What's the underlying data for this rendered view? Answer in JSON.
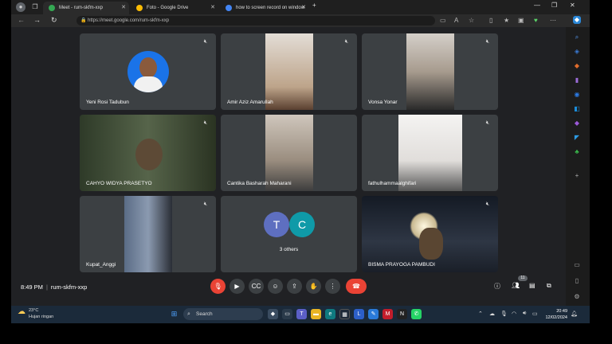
{
  "browser": {
    "tabs": [
      {
        "title": "Meet - rum-skfm-xxp",
        "fav_color": "#34a853"
      },
      {
        "title": "Foto - Google Drive",
        "fav_color": "#fbbc04"
      },
      {
        "title": "how to screen record on window",
        "fav_color": "#4285f4"
      }
    ],
    "new_tab": "+",
    "url": "https://meet.google.com/rum-skfm-xxp"
  },
  "participants": [
    {
      "name": "Yeni Rosi Tadubun",
      "bg": "#3c4043",
      "video": "#1a73e8"
    },
    {
      "name": "Amir Aziz Amarullah",
      "bg": "#3c4043",
      "video": "#cbb59e"
    },
    {
      "name": "Vonsa Yonar",
      "bg": "#3c4043",
      "video": "#b8b1a8"
    },
    {
      "name": "CAHYO WIDYA PRASETYO",
      "bg": "#3a4a33",
      "video": "#4d5b3c"
    },
    {
      "name": "Cantika Basharah Maharani",
      "bg": "#3c4043",
      "video": "#a4978a"
    },
    {
      "name": "fathulhammaalghifari",
      "bg": "#3c4043",
      "video": "#e7e5e3"
    },
    {
      "name": "Kupat_Anggi",
      "bg": "#3c4043",
      "video": "#6e7d92"
    },
    {
      "name": "3 others",
      "bg": "#3c4043",
      "avatars": [
        "T",
        "C"
      ]
    },
    {
      "name": "BISMA PRAYOGA PAMBUDI",
      "bg": "#1e2530",
      "video": "#2c3646"
    }
  ],
  "meeting": {
    "time": "8:49 PM",
    "code": "rum-skfm-xxp",
    "people_count": "11"
  },
  "taskbar": {
    "weather_temp": "23°C",
    "weather_desc": "Hujan ringan",
    "search_label": "Search",
    "time": "20:49",
    "date": "12/02/2024"
  }
}
